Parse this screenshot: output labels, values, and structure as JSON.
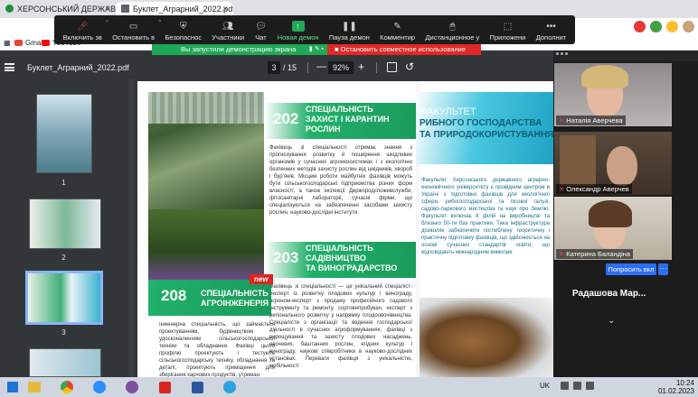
{
  "browser": {
    "tabs": [
      {
        "title": "ХЕРСОНСЬКИЙ ДЕРЖАВНИЙ АГ",
        "favicon_color": "#1f8f3a"
      },
      {
        "title": "Буклет_Аграрний_2022.pdf",
        "favicon_color": "#5f6368"
      }
    ],
    "bookmarks": [
      {
        "label": "Gmail",
        "color": "#ea4335"
      },
      {
        "label": "YouTube",
        "color": "#ff0000"
      }
    ]
  },
  "zoom_toolbar": {
    "items": [
      {
        "label": "Включить зв",
        "icon": "mic-muted-icon"
      },
      {
        "label": "Остановить в",
        "icon": "video-icon"
      },
      {
        "label": "Безопаснос",
        "icon": "shield-icon"
      },
      {
        "label": "Участники",
        "icon": "participants-icon",
        "count": "7"
      },
      {
        "label": "Чат",
        "icon": "chat-icon"
      },
      {
        "label": "Новая демон",
        "icon": "share-screen-icon"
      },
      {
        "label": "Пауза демон",
        "icon": "pause-icon"
      },
      {
        "label": "Комментир",
        "icon": "pencil-icon"
      },
      {
        "label": "Дистанционное у",
        "icon": "remote-control-icon"
      },
      {
        "label": "Приложени",
        "icon": "apps-icon"
      },
      {
        "label": "Дополнит",
        "icon": "more-icon"
      }
    ],
    "share_notice": "Вы запустили демонстрацию экрана",
    "stop_share": "Остановить совместное использование"
  },
  "pdf": {
    "filename": "Буклет_Аграрний_2022.pdf",
    "current_page": "3",
    "total_pages": "/ 15",
    "zoom": "92%",
    "zoom_minus": "—",
    "zoom_plus": "+",
    "thumbnails": [
      "1",
      "2",
      "3",
      "4"
    ],
    "document": {
      "sec1_num": "202",
      "sec1_title_1": "СПЕЦІАЛЬНІСТЬ",
      "sec1_title_2": "ЗАХИСТ І КАРАНТИН",
      "sec1_title_3": "РОСЛИН",
      "sec1_text": "Фахівець зі спеціальності отримає знання з прогнозування розвитку й поширення шкідливих організмів у сучасних агроекосистемах і з екологічно безпечних методів захисту рослин від шкідників, хвороб і бур'янів. Місцем роботи майбутніх фахівців можуть бути сільськогосподарські підприємства різних форм власності, а також інспекції Держпродспоживслужби, фітосанітарні лабораторії, сучасні фірми, що спеціалізуються на забезпеченні засобами захисту рослин, науково-дослідні інститути.",
      "sec2_num": "203",
      "sec2_title_1": "СПЕЦІАЛЬНІСТЬ",
      "sec2_title_2": "САДІВНИЦТВО",
      "sec2_title_3": "ТА ВИНОГРАДАРСТВО",
      "sec2_text": "Фахівець зі спеціальності — це унікальний спеціаліст-експерт із розвитку плодових культур і винограду, агроном-експерт з продажу професійного садового інструменту та ремонту, сортовипробувач, експерт з регіонального розвитку у напрямку плодоовочівництва. Спеціалісти з організації та ведення господарської діяльності в сучасних агроформуваннях, фахівці з вирощування та захисту плодових насаджень, овочевих, баштанних рослин, ягідних культур і винограду, наукові співробітники в науково-дослідних установах. Переваги фахівця з унікальністю, мобільності",
      "sec3_num": "208",
      "sec3_title_1": "СПЕЦІАЛЬНІСТЬ",
      "sec3_title_2": "АГРОІНЖЕНЕРІЯ",
      "sec3_badge": "new",
      "sec3_text": "Інженерна спеціальність, що займається проектуванням, будівництвом і удосконаленням сільськогосподарської техніки та обладнання. Фахівці цього профілю проектують і тестують сільськогосподарську техніку, обладнання та деталі, проектують приміщення для зберігання харчових продуктів, утриман",
      "fac_small": "ФАКУЛЬТЕТ",
      "fac_title_1": "РИБНОГО ГОСПОДАРСТВА",
      "fac_title_2": "ТА ПРИРОДОКОРИСТУВАННЯ",
      "fac_text": "Факультет Херсонського державного аграрно-економічного університету є провідним центром в Україні з підготовки фахівців для екологічної сфери, рибогосподарської та лісової галузі, садово-паркового мистецтва та наук про Землю. Факультет включає 8 філій на виробництві та близько 50-ти баз практики. Така інфраструктура дозволяє забезпечити поглиблену теоретичну і практичну підготовку фахівців, що здійснюється на основі сучасних стандартів освіти, що відповідають міжнародним вимогам."
    }
  },
  "participants": [
    {
      "name": "Наталія Аверчева",
      "muted": true
    },
    {
      "name": "Олександр Аверчев",
      "muted": true
    },
    {
      "name": "Катерина Баландіна",
      "muted": true
    },
    {
      "name": "Радашова Мар..."
    }
  ],
  "participant_actions": {
    "rename": "Переименовать",
    "rename_short": "Попросить вкл",
    "more": "···"
  },
  "taskbar": {
    "lang": "UK",
    "time": "10:24",
    "date": "01.02.2023"
  }
}
